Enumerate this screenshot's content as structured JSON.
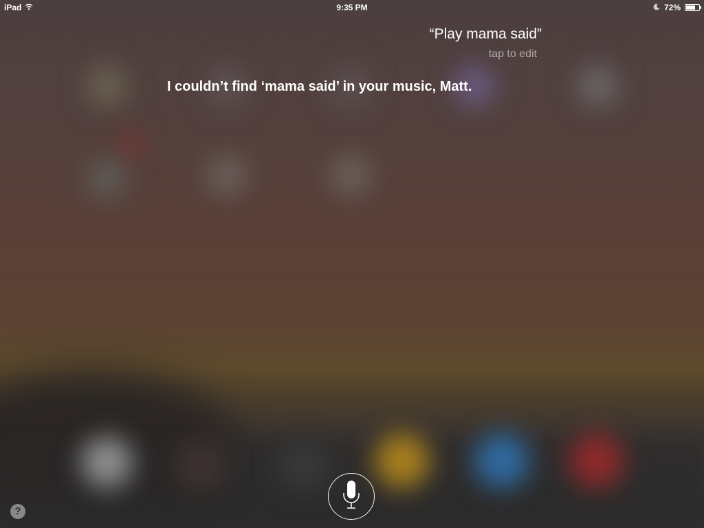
{
  "status_bar": {
    "device": "iPad",
    "time": "9:35 PM",
    "battery": "72%",
    "battery_level": 0.72,
    "icons": [
      "wifi-icon",
      "moon-icon",
      "battery-icon"
    ]
  },
  "siri": {
    "user_query": "“Play mama said”",
    "edit_hint": "tap to edit",
    "response": "I couldn’t find ‘mama said’ in your music, Matt."
  },
  "controls": {
    "mic_icon": "microphone-icon",
    "help_label": "?"
  },
  "colors": {
    "text": "#ffffff",
    "hint": "#a69c98",
    "background_top": "#4c3f3f",
    "background_bottom": "#2f2f2f"
  }
}
